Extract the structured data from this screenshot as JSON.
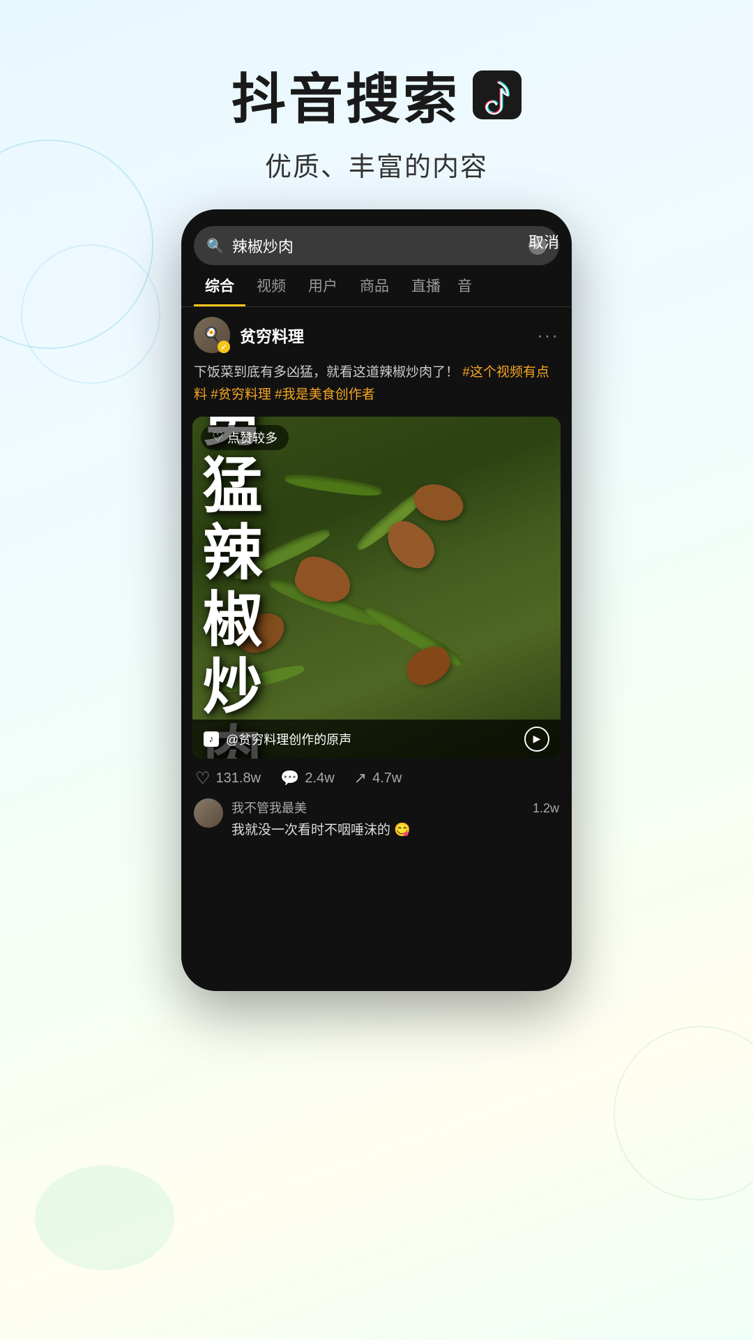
{
  "header": {
    "title": "抖音搜索",
    "tiktok_logo": "♪",
    "subtitle": "优质、丰富的内容"
  },
  "search": {
    "query": "辣椒炒肉",
    "cancel_label": "取消",
    "clear_icon": "×"
  },
  "tabs": [
    {
      "label": "综合",
      "active": true
    },
    {
      "label": "视频",
      "active": false
    },
    {
      "label": "用户",
      "active": false
    },
    {
      "label": "商品",
      "active": false
    },
    {
      "label": "直播",
      "active": false
    },
    {
      "label": "音",
      "active": false
    }
  ],
  "post": {
    "username": "贫穷料理",
    "verified": true,
    "description": "下饭菜到底有多凶猛，就看这道辣椒炒肉了！",
    "tags": "#这个视频有点料 #贫穷料理 #我是美食创作者",
    "video_overlay": "勇猛的辣椒炒肉",
    "likes_badge": "点赞较多",
    "audio_text": "@贫穷料理创作的原声",
    "engagement": {
      "likes": "131.8w",
      "comments": "2.4w",
      "shares": "4.7w"
    }
  },
  "comments": [
    {
      "username": "我不管我最美",
      "text": "我就没一次看时不咽唾沫的 😋",
      "count": "1.2w"
    }
  ],
  "icons": {
    "search": "🔍",
    "more": "···",
    "heart": "♥",
    "comment": "💬",
    "share": "➤",
    "play": "▶",
    "tiktok": "♪",
    "verified": "✓"
  }
}
